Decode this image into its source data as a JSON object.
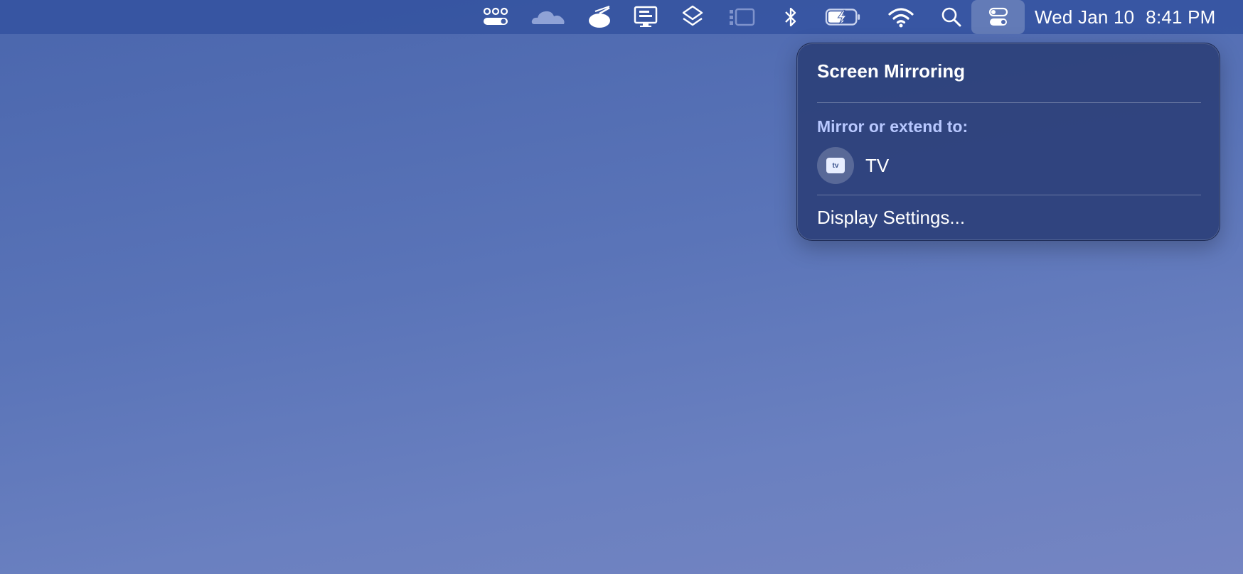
{
  "menubar": {
    "icons": [
      "toggles-icon",
      "cloudflare-icon",
      "bowl-icon",
      "display-monitor-icon",
      "layers-icon",
      "stage-manager-icon",
      "bluetooth-icon",
      "battery-charging-icon",
      "wifi-icon",
      "search-icon",
      "control-center-icon"
    ],
    "date": "Wed Jan 10",
    "time": "8:41 PM"
  },
  "panel": {
    "title": "Screen Mirroring",
    "section_label": "Mirror or extend to:",
    "devices": [
      {
        "name": "TV",
        "icon": "apple-tv-icon",
        "icon_text": "tv"
      }
    ],
    "footer_item": "Display Settings..."
  }
}
